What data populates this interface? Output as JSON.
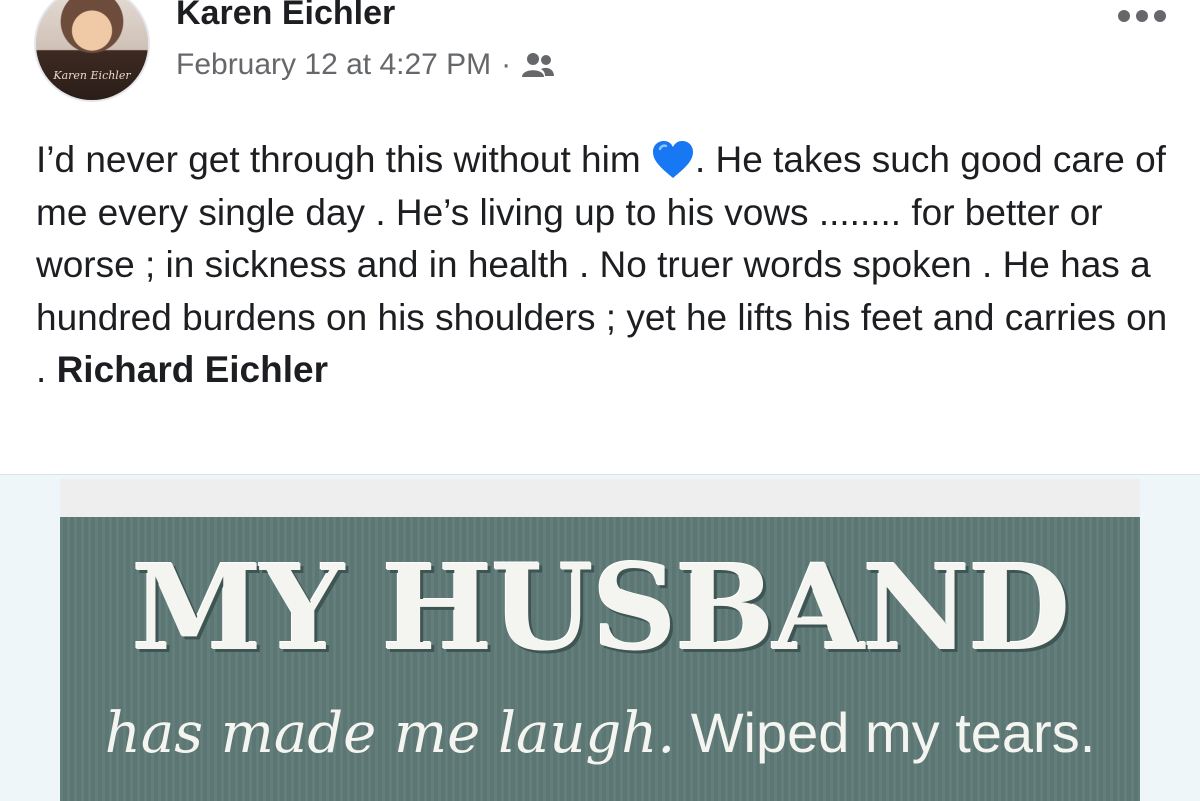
{
  "post": {
    "author": "Karen Eichler",
    "timestamp": "February 12 at 4:27 PM",
    "separator": "·",
    "audience_icon": "friends-icon",
    "more_icon": "more-options-icon",
    "avatar_signature": "Karen Eichler",
    "text_part1": "I’d never get through this without him ",
    "text_emoji": "blue-heart-icon",
    "text_part2": ". He takes such good care of me every single day . He’s living up to his vows ........ for better or worse ; in sickness and in health . No truer words spoken . He has a hundred burdens on his shoulders ; yet he lifts his feet and carries on . ",
    "mention": "Richard Eichler"
  },
  "image": {
    "title": "MY HUSBAND",
    "line_script": "has made me laugh.",
    "line_plain": " Wiped my tears."
  },
  "colors": {
    "heart": "#1877f2",
    "sign": "#5f7a77",
    "meta_text": "#65676b"
  }
}
